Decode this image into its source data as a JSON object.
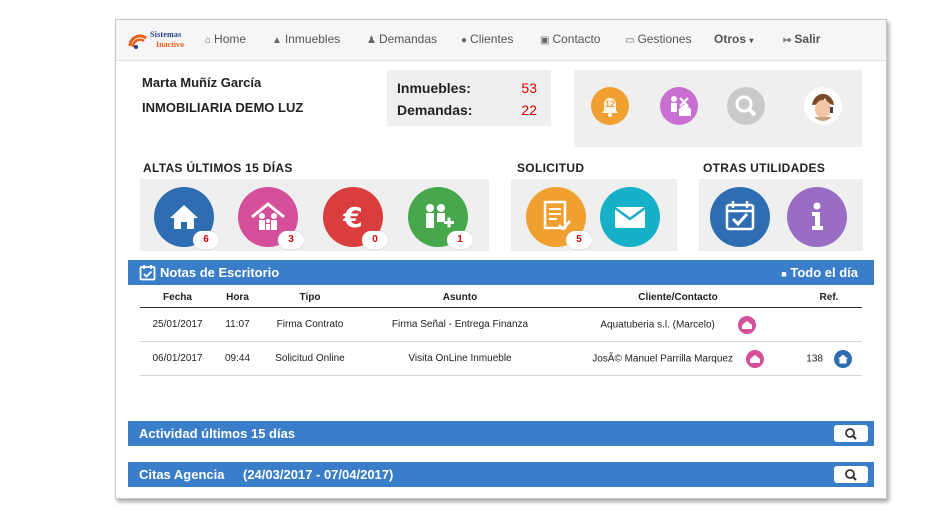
{
  "logo": {
    "line1": "Sistemas",
    "line2": "Inactivo"
  },
  "nav": {
    "home": "Home",
    "inmuebles": "Inmuebles",
    "demandas": "Demandas",
    "clientes": "Clientes",
    "contacto": "Contacto",
    "gestiones": "Gestiones",
    "otros": "Otros",
    "salir": "Salir"
  },
  "user": {
    "name": "Marta Muñíz García",
    "company": "INMOBILIARIA DEMO LUZ"
  },
  "stats": {
    "inmuebles_label": "Inmuebles:",
    "inmuebles_value": "53",
    "demandas_label": "Demandas:",
    "demandas_value": "22"
  },
  "quick": {
    "alerts_count": "12",
    "icons": [
      "bell-icon",
      "property-client-icon",
      "search-icon",
      "support-agent-icon"
    ]
  },
  "sections": {
    "altas": {
      "title": "ALTAS ÚLTIMOS 15 DÍAS",
      "items": [
        {
          "name": "inmuebles",
          "badge": "6",
          "color": "#2f6db3"
        },
        {
          "name": "demandas",
          "badge": "3",
          "color": "#d4509b"
        },
        {
          "name": "ventas",
          "badge": "0",
          "color": "#d93d3d"
        },
        {
          "name": "clientes",
          "badge": "1",
          "color": "#47a84b"
        }
      ]
    },
    "solicitud": {
      "title": "SOLICITUD",
      "items": [
        {
          "name": "solicitudes",
          "badge": "5",
          "color": "#f0a030"
        },
        {
          "name": "mensajes",
          "badge": "",
          "color": "#16b0c8"
        }
      ]
    },
    "otras": {
      "title": "OTRAS UTILIDADES",
      "items": [
        {
          "name": "agenda",
          "color": "#2f6db3"
        },
        {
          "name": "informacion",
          "color": "#9a6dc4"
        }
      ]
    }
  },
  "notes": {
    "title": "Notas de Escritorio",
    "filter": "Todo el día",
    "columns": [
      "Fecha",
      "Hora",
      "Tipo",
      "Asunto",
      "Cliente/Contacto",
      "Ref."
    ],
    "rows": [
      {
        "fecha": "25/01/2017",
        "hora": "11:07",
        "tipo": "Firma Contrato",
        "asunto": "Firma Señal - Entrega Finanza",
        "cliente": "Aquatuberia s.l. (Marcelo)",
        "ref": ""
      },
      {
        "fecha": "06/01/2017",
        "hora": "09:44",
        "tipo": "Solicitud Online",
        "asunto": "Visita OnLine Inmueble",
        "cliente": "JosÃ© Manuel Parrilla Marquez",
        "ref": "138"
      }
    ]
  },
  "actividad": {
    "title": "Actividad últimos 15 días"
  },
  "citas": {
    "title": "Citas Agencia",
    "range": "(24/03/2017 - 07/04/2017)"
  },
  "colors": {
    "accent": "#3a7dc9",
    "badge_text": "#dd0000",
    "panel": "#efefef"
  }
}
